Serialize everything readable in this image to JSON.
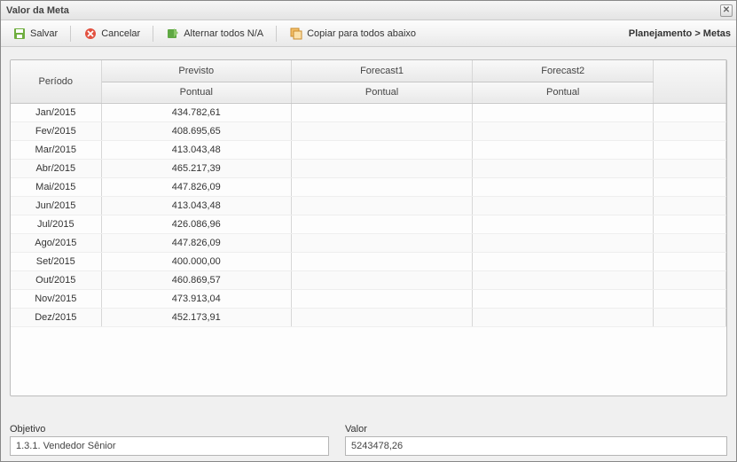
{
  "window": {
    "title": "Valor da Meta"
  },
  "toolbar": {
    "save": "Salvar",
    "cancel": "Cancelar",
    "toggle_na": "Alternar todos N/A",
    "copy_down": "Copiar para todos abaixo"
  },
  "breadcrumb": "Planejamento > Metas",
  "headers": {
    "periodo": "Período",
    "previsto": "Previsto",
    "forecast1": "Forecast1",
    "forecast2": "Forecast2",
    "pontual": "Pontual"
  },
  "rows": [
    {
      "periodo": "Jan/2015",
      "previsto": "434.782,61",
      "f1": "",
      "f2": ""
    },
    {
      "periodo": "Fev/2015",
      "previsto": "408.695,65",
      "f1": "",
      "f2": ""
    },
    {
      "periodo": "Mar/2015",
      "previsto": "413.043,48",
      "f1": "",
      "f2": ""
    },
    {
      "periodo": "Abr/2015",
      "previsto": "465.217,39",
      "f1": "",
      "f2": ""
    },
    {
      "periodo": "Mai/2015",
      "previsto": "447.826,09",
      "f1": "",
      "f2": ""
    },
    {
      "periodo": "Jun/2015",
      "previsto": "413.043,48",
      "f1": "",
      "f2": ""
    },
    {
      "periodo": "Jul/2015",
      "previsto": "426.086,96",
      "f1": "",
      "f2": ""
    },
    {
      "periodo": "Ago/2015",
      "previsto": "447.826,09",
      "f1": "",
      "f2": ""
    },
    {
      "periodo": "Set/2015",
      "previsto": "400.000,00",
      "f1": "",
      "f2": ""
    },
    {
      "periodo": "Out/2015",
      "previsto": "460.869,57",
      "f1": "",
      "f2": ""
    },
    {
      "periodo": "Nov/2015",
      "previsto": "473.913,04",
      "f1": "",
      "f2": ""
    },
    {
      "periodo": "Dez/2015",
      "previsto": "452.173,91",
      "f1": "",
      "f2": ""
    }
  ],
  "bottom": {
    "objetivo_label": "Objetivo",
    "objetivo_value": "1.3.1. Vendedor Sênior",
    "valor_label": "Valor",
    "valor_value": "5243478,26"
  }
}
